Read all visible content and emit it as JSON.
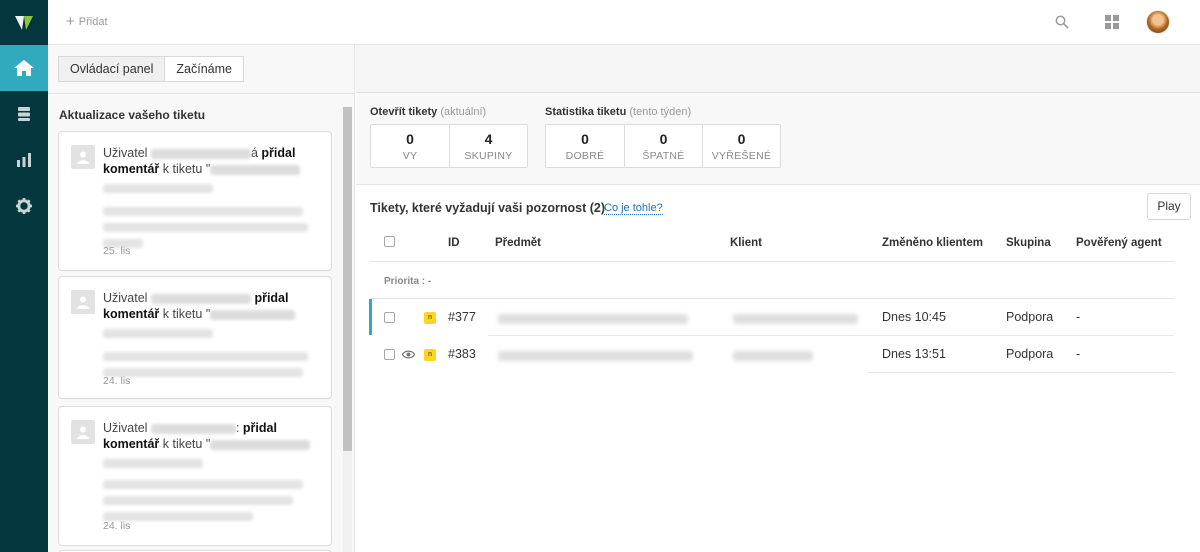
{
  "topbar": {
    "add_label": "Přidat",
    "icons": [
      "search-icon",
      "apps-grid-icon",
      "user-avatar"
    ]
  },
  "nav": {
    "items": [
      "home-icon",
      "views-icon",
      "reports-icon",
      "admin-gear-icon"
    ],
    "active": "home"
  },
  "left_panel": {
    "tabs": [
      {
        "label": "Ovládací panel",
        "active": true
      },
      {
        "label": "Začínáme",
        "active": false
      }
    ],
    "title": "Aktualizace vašeho tiketu",
    "cards": [
      {
        "prefix": "Uživatel",
        "suffix": "á",
        "action": "přidal komentář",
        "mid": " k tiketu \"",
        "date": "25. lis"
      },
      {
        "prefix": "Uživatel",
        "suffix": "",
        "action": "přidal komentář",
        "mid": " k tiketu \"",
        "date": "24. lis"
      },
      {
        "prefix": "Uživatel",
        "suffix": ":",
        "action": "přidal komentář",
        "mid": " k tiketu \"",
        "date": "24. lis"
      }
    ]
  },
  "stats": {
    "open": {
      "title": "Otevřít tikety",
      "qualifier": "(aktuální)",
      "boxes": [
        {
          "value": "0",
          "label": "VY"
        },
        {
          "value": "4",
          "label": "SKUPINY"
        }
      ]
    },
    "ticket_stats": {
      "title": "Statistika tiketu",
      "qualifier": "(tento týden)",
      "boxes": [
        {
          "value": "0",
          "label": "DOBRÉ"
        },
        {
          "value": "0",
          "label": "ŠPATNÉ"
        },
        {
          "value": "0",
          "label": "VYŘEŠENÉ"
        }
      ]
    }
  },
  "view": {
    "title": "Tikety, které vyžadují vaši pozornost",
    "count": "(2)",
    "help_link": "Co je tohle?",
    "play_label": "Play",
    "columns": {
      "id": "ID",
      "subject": "Předmět",
      "client": "Klient",
      "changed": "Změněno klientem",
      "group": "Skupina",
      "agent": "Pověřený agent"
    },
    "group_label": "Priorita : -",
    "rows": [
      {
        "id": "#377",
        "status": "n",
        "changed": "Dnes 10:45",
        "group": "Podpora",
        "agent": "-"
      },
      {
        "id": "#383",
        "status": "n",
        "changed": "Dnes 13:51",
        "group": "Podpora",
        "agent": "-"
      }
    ]
  },
  "colors": {
    "nav_bg": "#03363d",
    "nav_active": "#30aabc",
    "status_new": "#ffd424",
    "link": "#1f73b7"
  }
}
